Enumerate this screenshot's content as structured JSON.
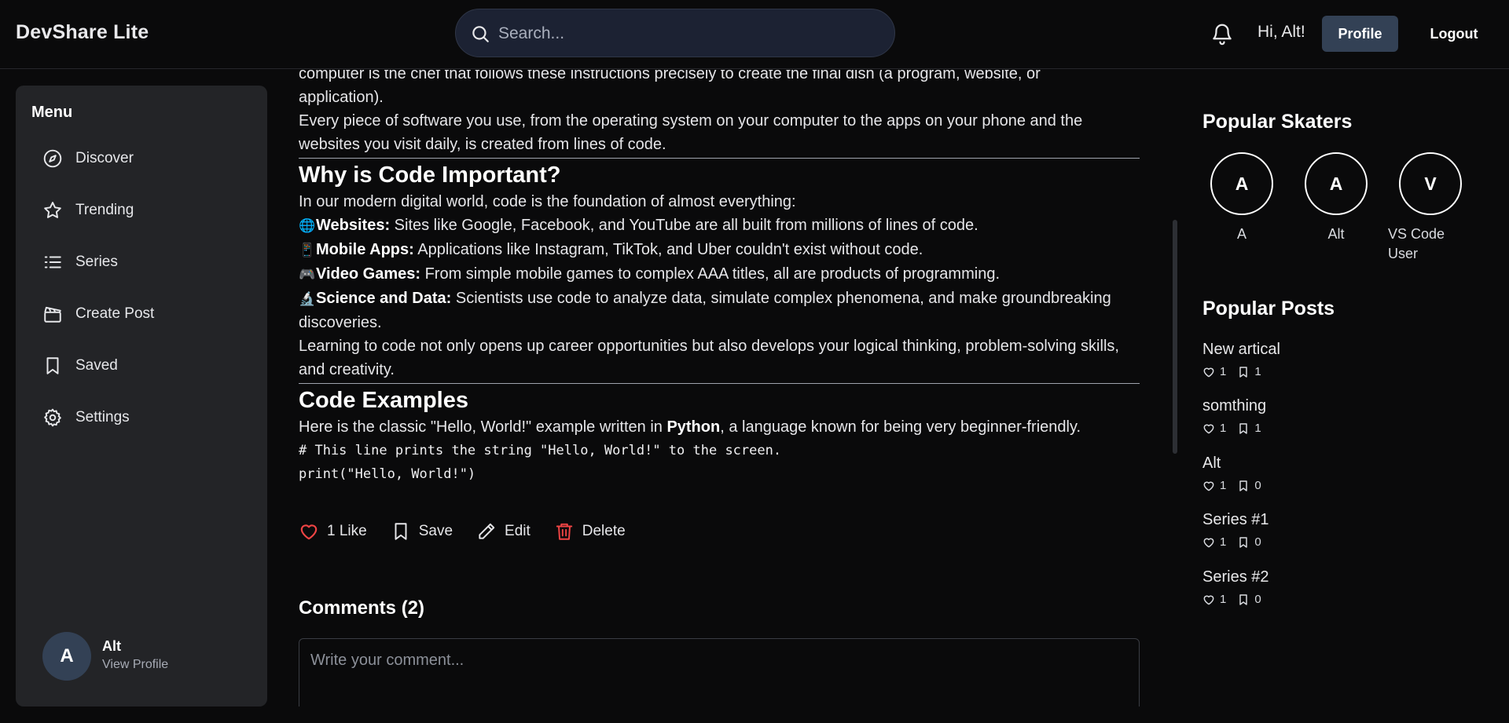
{
  "app": {
    "brand": "DevShare Lite"
  },
  "header": {
    "search_placeholder": "Search...",
    "greeting": "Hi, Alt!",
    "profile_label": "Profile",
    "logout_label": "Logout"
  },
  "sidebar": {
    "title": "Menu",
    "items": [
      {
        "label": "Discover",
        "icon": "compass-icon"
      },
      {
        "label": "Trending",
        "icon": "star-icon"
      },
      {
        "label": "Series",
        "icon": "list-icon"
      },
      {
        "label": "Create Post",
        "icon": "clapperboard-icon"
      },
      {
        "label": "Saved",
        "icon": "bookmark-icon"
      },
      {
        "label": "Settings",
        "icon": "gear-icon"
      }
    ],
    "user": {
      "initial": "A",
      "name": "Alt",
      "link": "View Profile"
    }
  },
  "article": {
    "intro_line1": "computer is the chef that follows these instructions precisely to create the final dish (a program, website, or",
    "intro_line2": "application).",
    "intro_para": "Every piece of software you use, from the operating system on your computer to the apps on your phone and the websites you visit daily, is created from lines of code.",
    "h_important": "Why is Code Important?",
    "important_lead": "In our modern digital world, code is the foundation of almost everything:",
    "bullets": [
      {
        "emoji": "🌐",
        "bold": "Websites:",
        "text": " Sites like Google, Facebook, and YouTube are all built from millions of lines of code."
      },
      {
        "emoji": "📱",
        "bold": "Mobile Apps:",
        "text": " Applications like Instagram, TikTok, and Uber couldn't exist without code."
      },
      {
        "emoji": "🎮",
        "bold": "Video Games:",
        "text": " From simple mobile games to complex AAA titles, all are products of programming."
      },
      {
        "emoji": "🔬",
        "bold": "Science and Data:",
        "text": " Scientists use code to analyze data, simulate complex phenomena, and make groundbreaking discoveries."
      }
    ],
    "learning_para": "Learning to code not only opens up career opportunities but also develops your logical thinking, problem-solving skills, and creativity.",
    "h_examples": "Code Examples",
    "examples_pre": "Here is the classic \"Hello, World!\" example written in ",
    "examples_bold": "Python",
    "examples_post": ", a language known for being very beginner-friendly.",
    "code_line1": "# This line prints the string \"Hello, World!\" to the screen.",
    "code_line2": "print(\"Hello, World!\")"
  },
  "actions": {
    "like": "1 Like",
    "save": "Save",
    "edit": "Edit",
    "delete": "Delete"
  },
  "comments": {
    "title": "Comments (2)",
    "placeholder": "Write your comment..."
  },
  "rail": {
    "skaters_title": "Popular Skaters",
    "skaters": [
      {
        "initial": "A",
        "name": "A"
      },
      {
        "initial": "A",
        "name": "Alt"
      },
      {
        "initial": "V",
        "name": "VS Code User"
      }
    ],
    "posts_title": "Popular Posts",
    "posts": [
      {
        "title": "New artical",
        "likes": "1",
        "saves": "1"
      },
      {
        "title": "somthing",
        "likes": "1",
        "saves": "1"
      },
      {
        "title": "Alt",
        "likes": "1",
        "saves": "0"
      },
      {
        "title": "Series #1",
        "likes": "1",
        "saves": "0"
      },
      {
        "title": "Series #2",
        "likes": "1",
        "saves": "0"
      }
    ]
  },
  "colors": {
    "accent_red": "#ef4444",
    "profile_button": "#334155",
    "search_bg": "#1c2233",
    "sidebar_bg": "#232427"
  }
}
